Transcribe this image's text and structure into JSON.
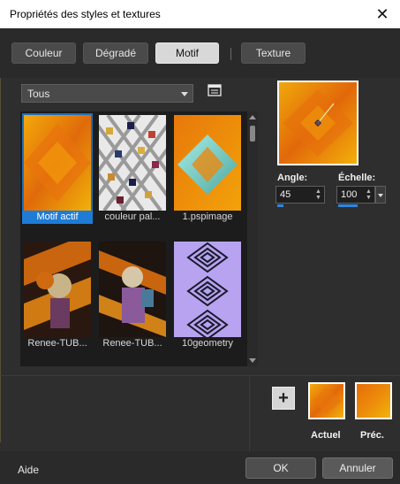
{
  "window": {
    "title": "Propriétés des styles et textures",
    "close_glyph": "✕"
  },
  "tabs": [
    {
      "label": "Couleur",
      "active": false
    },
    {
      "label": "Dégradé",
      "active": false
    },
    {
      "label": "Motif",
      "active": true
    },
    {
      "label": "Texture",
      "active": false
    }
  ],
  "category": {
    "selected": "Tous"
  },
  "patterns": [
    {
      "caption": "Motif actif",
      "selected": true
    },
    {
      "caption": "couleur pal...",
      "selected": false
    },
    {
      "caption": "1.pspimage",
      "selected": false
    },
    {
      "caption": "Renee-TUB...",
      "selected": false
    },
    {
      "caption": "Renee-TUB...",
      "selected": false
    },
    {
      "caption": "10geometry",
      "selected": false
    }
  ],
  "settings": {
    "angle_label": "Angle:",
    "angle_value": "45",
    "angle_level": 0.125,
    "scale_label": "Échelle:",
    "scale_value": "100",
    "scale_level": 0.4
  },
  "swatches": {
    "current_label": "Actuel",
    "previous_label": "Préc.",
    "add_glyph": "+"
  },
  "footer": {
    "help_label": "Aide",
    "ok_label": "OK",
    "cancel_label": "Annuler"
  },
  "colors": {
    "accent": "#1e7cd6",
    "orange": "#e8850c",
    "gold": "#f2b700"
  }
}
